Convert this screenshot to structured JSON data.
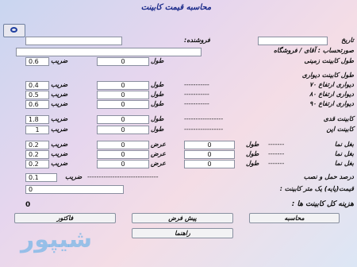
{
  "title": "محاسبه قیمت کابینت",
  "header": {
    "date_label": "تاریخ",
    "seller_label": "فروشنده:",
    "account_label": "صورتحساب : آقای / فروشگاه"
  },
  "floor": {
    "label": "طول کابینت زمینی",
    "length_label": "طول",
    "length_value": "0",
    "factor_label": "ضریب",
    "factor_value": "0.6"
  },
  "wall_title": "طول کابینت دیواری",
  "wall_rows": [
    {
      "label": "دیواری ارتفاع ۷۰",
      "length_label": "طول",
      "length_value": "0",
      "factor_label": "ضریب",
      "factor_value": "0.4"
    },
    {
      "label": "دیواری ارتفاع ۸۰",
      "length_label": "طول",
      "length_value": "0",
      "factor_label": "ضریب",
      "factor_value": "0.5"
    },
    {
      "label": "دیواری ارتفاع ۹۰",
      "length_label": "طول",
      "length_value": "0",
      "factor_label": "ضریب",
      "factor_value": "0.6"
    }
  ],
  "tall": {
    "label": "کابینت قدی",
    "length_label": "طول",
    "length_value": "0",
    "factor_label": "ضریب",
    "factor_value": "1.8"
  },
  "oven": {
    "label": "کابینت اپن",
    "length_label": "طول",
    "length_value": "0",
    "factor_label": "ضریب",
    "factor_value": "1"
  },
  "side_rows": [
    {
      "label": "بغل نما",
      "length_label": "طول",
      "length_value": "0",
      "width_label": "عرض",
      "width_value": "0",
      "factor_label": "ضریب",
      "factor_value": "0.2"
    },
    {
      "label": "بغل نما",
      "length_label": "طول",
      "length_value": "0",
      "width_label": "عرض",
      "width_value": "0",
      "factor_label": "ضریب",
      "factor_value": "0.2"
    },
    {
      "label": "بغل نما",
      "length_label": "طول",
      "length_value": "0",
      "width_label": "عرض",
      "width_value": "0",
      "factor_label": "ضریب",
      "factor_value": "0.2"
    }
  ],
  "install": {
    "label": "درصد حمل و نصب",
    "factor_label": "ضریب",
    "factor_value": "0.1"
  },
  "price": {
    "label": "قیمت(پایه) یک متر کابینت :",
    "value": "0"
  },
  "total": {
    "label": "هزینه کل کابینت ها :",
    "value": "0"
  },
  "buttons": {
    "calc": "محاسبه",
    "preinvoice": "پیش فرض",
    "invoice": "فاکتور",
    "guide": "راهنما"
  },
  "watermark": "شیپور"
}
